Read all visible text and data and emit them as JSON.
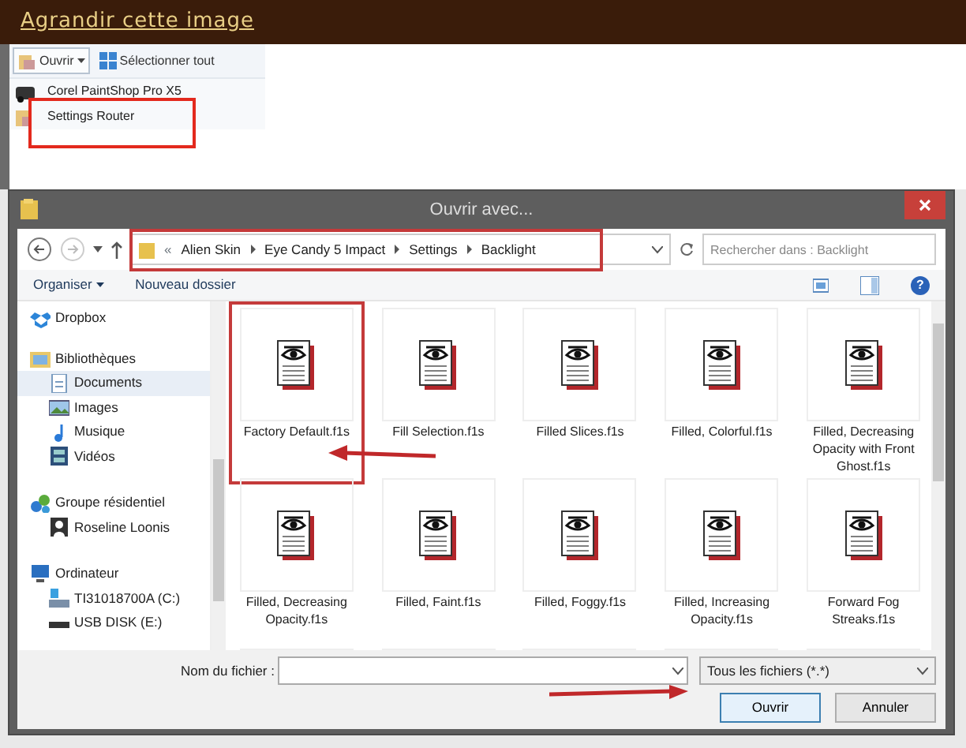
{
  "header": {
    "link": "Agrandir cette image"
  },
  "toolbar": {
    "open_button": "Ouvrir",
    "select_all": "Sélectionner tout"
  },
  "open_with_menu": [
    {
      "label": "Corel PaintShop Pro X5",
      "highlighted": false
    },
    {
      "label": "Settings Router",
      "highlighted": true
    }
  ],
  "dialog": {
    "title": "Ouvrir avec...",
    "address": {
      "overflow": "«",
      "path": [
        "Alien Skin",
        "Eye Candy 5 Impact",
        "Settings",
        "Backlight"
      ],
      "highlighted": true
    },
    "search": {
      "placeholder": "Rechercher dans : Backlight"
    },
    "commands": [
      "Organiser",
      "Nouveau dossier"
    ],
    "help": "?",
    "sidebar": [
      {
        "label": "Dropbox",
        "kind": "dropbox",
        "selected": false
      },
      {
        "label": "Bibliothèques",
        "kind": "libraries",
        "selected": false,
        "children": [
          {
            "label": "Documents",
            "kind": "documents",
            "selected": true
          },
          {
            "label": "Images",
            "kind": "images",
            "selected": false
          },
          {
            "label": "Musique",
            "kind": "music",
            "selected": false
          },
          {
            "label": "Vidéos",
            "kind": "videos",
            "selected": false
          }
        ]
      },
      {
        "label": "Groupe résidentiel",
        "kind": "homegroup",
        "selected": false,
        "children": [
          {
            "label": "Roseline Loonis",
            "kind": "user",
            "selected": false
          }
        ]
      },
      {
        "label": "Ordinateur",
        "kind": "computer",
        "selected": false,
        "children": [
          {
            "label": "TI31018700A (C:)",
            "kind": "drive",
            "selected": false
          },
          {
            "label": "USB DISK (E:)",
            "kind": "usb",
            "selected": false
          }
        ]
      }
    ],
    "files": [
      {
        "name": "Factory Default.f1s",
        "highlighted": true
      },
      {
        "name": "Fill Selection.f1s",
        "highlighted": false
      },
      {
        "name": "Filled Slices.f1s",
        "highlighted": false
      },
      {
        "name": "Filled, Colorful.f1s",
        "highlighted": false
      },
      {
        "name": "Filled, Decreasing Opacity with Front Ghost.f1s",
        "highlighted": false
      },
      {
        "name": "Filled, Decreasing Opacity.f1s",
        "highlighted": false
      },
      {
        "name": "Filled, Faint.f1s",
        "highlighted": false
      },
      {
        "name": "Filled, Foggy.f1s",
        "highlighted": false
      },
      {
        "name": "Filled, Increasing Opacity.f1s",
        "highlighted": false
      },
      {
        "name": "Forward Fog Streaks.f1s",
        "highlighted": false
      }
    ],
    "filename": {
      "label": "Nom du fichier :"
    },
    "filter": "Tous les fichiers (*.*)",
    "buttons": [
      "Ouvrir",
      "Annuler"
    ]
  }
}
